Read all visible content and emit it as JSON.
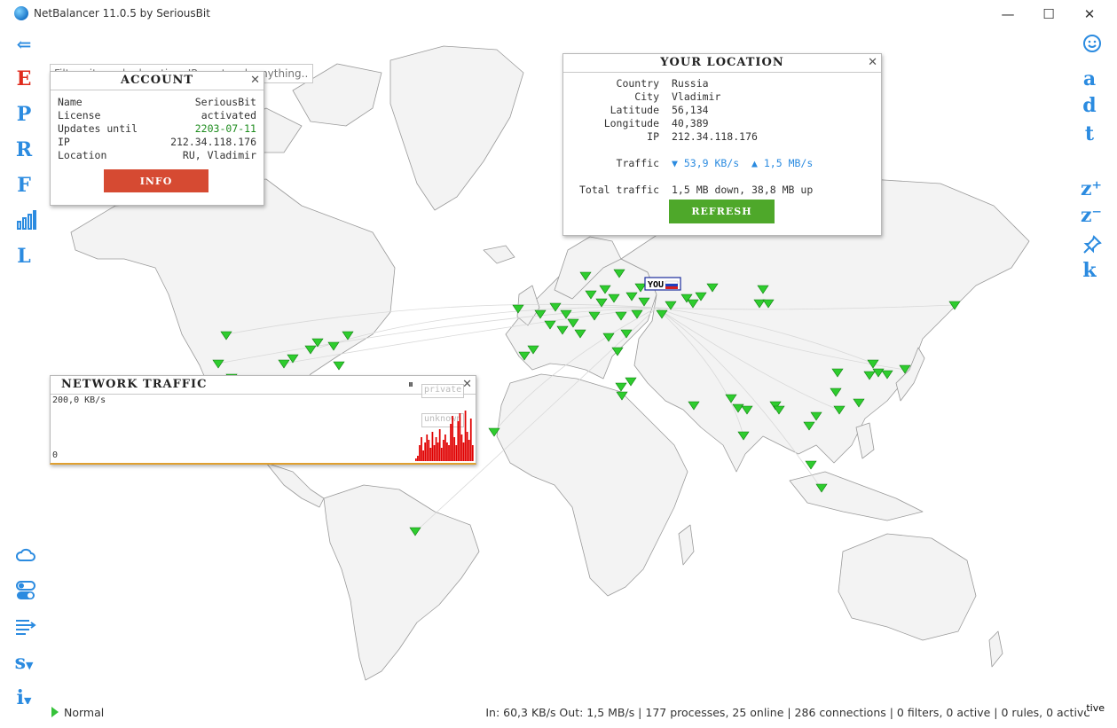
{
  "window": {
    "title": "NetBalancer 11.0.5 by SeriousBit",
    "minimize_glyph": "—",
    "maximize_glyph": "☐",
    "close_glyph": "✕"
  },
  "filter": {
    "placeholder": "Filters items by location, IP, protocol, anything..."
  },
  "left_sidebar": {
    "back_glyph": "⇐",
    "items": [
      {
        "label": "E",
        "color": "#e02a1c"
      },
      {
        "label": "P",
        "color": "#2b8be0"
      },
      {
        "label": "R",
        "color": "#2b8be0"
      },
      {
        "label": "F",
        "color": "#2b8be0"
      },
      {
        "label": "L",
        "color": "#2b8be0"
      }
    ],
    "bottom_items": [
      {
        "label": "s"
      },
      {
        "label": "i"
      }
    ]
  },
  "right_sidebar": {
    "items": [
      {
        "label": "a"
      },
      {
        "label": "d"
      },
      {
        "label": "t"
      },
      {
        "label": "z⁺"
      },
      {
        "label": "z⁻"
      },
      {
        "label": "k"
      }
    ]
  },
  "account": {
    "title": "ACCOUNT",
    "close_glyph": "✕",
    "rows": [
      {
        "key": "Name",
        "value": "SeriousBit"
      },
      {
        "key": "License",
        "value": "activated"
      },
      {
        "key": "Updates until",
        "value": "2203-07-11",
        "color": "#1e8c1e"
      },
      {
        "key": "IP",
        "value": "212.34.118.176"
      },
      {
        "key": "Location",
        "value": "RU, Vladimir"
      }
    ],
    "button": "INFO"
  },
  "your_location": {
    "title": "YOUR LOCATION",
    "close_glyph": "✕",
    "rows": [
      {
        "key": "Country",
        "value": "Russia"
      },
      {
        "key": "City",
        "value": "Vladimir"
      },
      {
        "key": "Latitude",
        "value": "56,134"
      },
      {
        "key": "Longitude",
        "value": "40,389"
      },
      {
        "key": "IP",
        "value": "212.34.118.176"
      }
    ],
    "traffic_label": "Traffic",
    "traffic_down": "▼ 53,9 KB/s",
    "traffic_up": "▲ 1,5 MB/s",
    "total_label": "Total traffic",
    "total_value": "1,5 MB down, 38,8 MB up",
    "button": "REFRESH"
  },
  "network_traffic": {
    "title": "NETWORK TRAFFIC",
    "pause_glyph": "⏸",
    "close_glyph": "✕",
    "ghost_tags": [
      "private",
      "unknown"
    ],
    "y_max_label": "200,0 KB/s",
    "y_min_label": "0",
    "bar_color": "#e00000",
    "bars": [
      0.05,
      0.1,
      0.3,
      0.45,
      0.2,
      0.35,
      0.5,
      0.4,
      0.25,
      0.55,
      0.3,
      0.45,
      0.35,
      0.6,
      0.25,
      0.4,
      0.5,
      0.35,
      0.3,
      0.7,
      0.85,
      0.45,
      0.3,
      0.75,
      0.9,
      0.5,
      0.35,
      0.95,
      0.55,
      0.4,
      0.8,
      0.3
    ]
  },
  "map": {
    "you_label": "YOU",
    "marker_color": "#2ecc2e"
  },
  "status": {
    "mode": "Normal",
    "summary": "In: 60,3 KB/s  Out: 1,5 MB/s  |  177 processes, 25 online  | 286 connections  | 0 filters, 0 active  |  0 rules, 0 active",
    "tail": "tive"
  }
}
